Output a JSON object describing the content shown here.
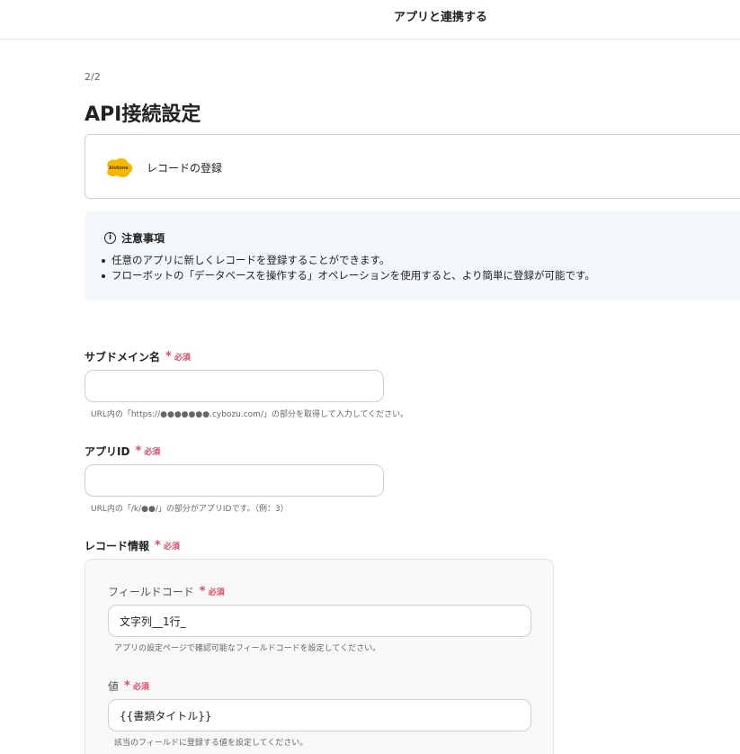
{
  "header": {
    "title": "アプリと連携する"
  },
  "step": "2/2",
  "page_title": "API接続設定",
  "action": {
    "label": "レコードの登録",
    "logo_text": "kintone",
    "logo_color": "#f5b800"
  },
  "notice": {
    "title": "注意事項",
    "items": [
      "任意のアプリに新しくレコードを登録することができます。",
      "フローボットの「データベースを操作する」オペレーションを使用すると、より簡単に登録が可能です。"
    ]
  },
  "required_text": "必須",
  "required_color": "#e0485f",
  "fields": {
    "subdomain": {
      "label": "サブドメイン名",
      "value": "",
      "hint": "URL内の「https://●●●●●●●.cybozu.com/」の部分を取得して入力してください。"
    },
    "app_id": {
      "label": "アプリID",
      "value": "",
      "hint": "URL内の「/k/●●/」の部分がアプリIDです。（例：3）"
    },
    "record_info": {
      "label": "レコード情報",
      "field_code": {
        "label": "フィールドコード",
        "value": "文字列__1行_",
        "hint": "アプリの設定ページで確認可能なフィールドコードを設定してください。"
      },
      "value": {
        "label": "値",
        "value": "{{書類タイトル}}",
        "hint": "該当のフィールドに登録する値を設定してください。"
      }
    }
  }
}
